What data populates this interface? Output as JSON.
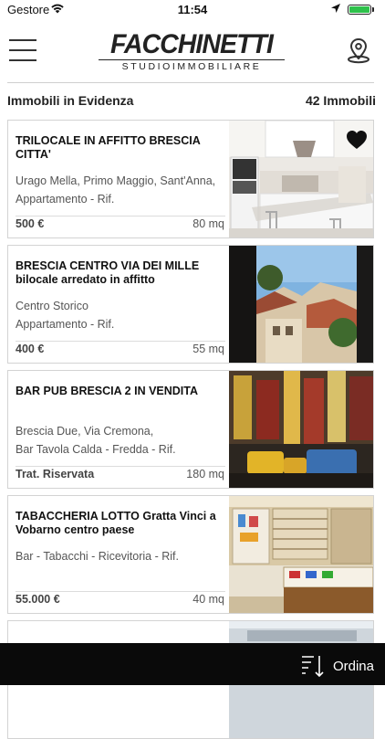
{
  "status_bar": {
    "carrier": "Gestore",
    "time": "11:54"
  },
  "header": {
    "logo_title": "FACCHINETTI",
    "logo_subtitle": "STUDIOIMMOBILIARE"
  },
  "summary": {
    "section_title": "Immobili in Evidenza",
    "count_label": "42 Immobili"
  },
  "listings": [
    {
      "title": "TRILOCALE IN AFFITTO BRESCIA CITTA'",
      "location": "Urago Mella, Primo Maggio, Sant'Anna,",
      "type": "Appartamento - Rif.",
      "price": "500 €",
      "size": "80 mq",
      "favorite": true
    },
    {
      "title": "BRESCIA CENTRO VIA DEI MILLE bilocale arredato in affitto",
      "location": "Centro Storico",
      "type": "Appartamento - Rif.",
      "price": "400 €",
      "size": "55 mq",
      "favorite": false
    },
    {
      "title": "BAR PUB BRESCIA 2 IN VENDITA",
      "location": "Brescia Due, Via Cremona,",
      "type": "Bar Tavola Calda - Fredda - Rif.",
      "price": "Trat. Riservata",
      "size": "180 mq",
      "favorite": false
    },
    {
      "title": "TABACCHERIA LOTTO Gratta Vinci a Vobarno centro paese",
      "location": "Bar - Tabacchi - Ricevitoria - Rif.",
      "type": "",
      "price": "55.000 €",
      "size": "40 mq",
      "favorite": false
    }
  ],
  "bottom_bar": {
    "sort_label": "Ordina"
  },
  "colors": {
    "battery": "#2ec14b",
    "bottom_bar": "#0a0a0a"
  }
}
